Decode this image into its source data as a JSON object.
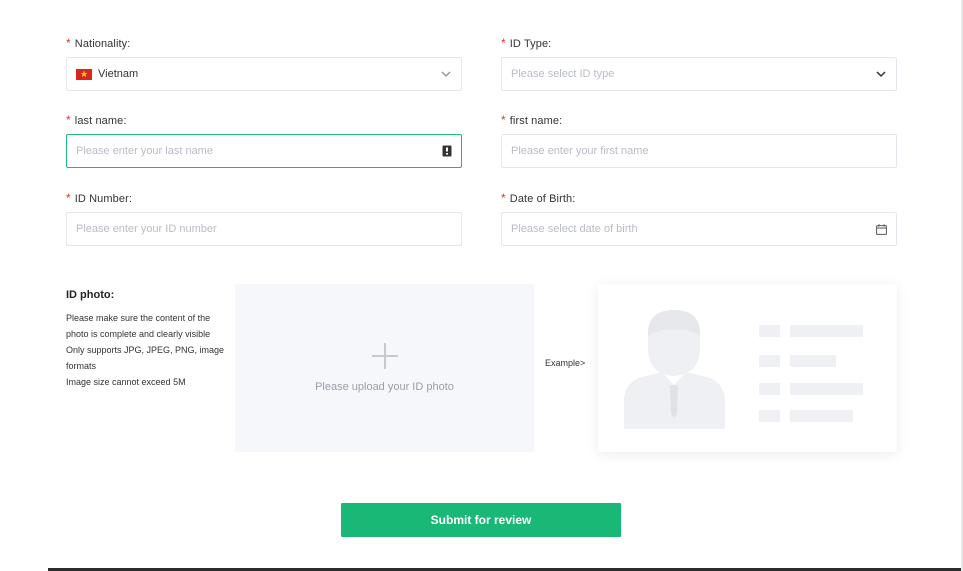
{
  "form": {
    "required_mark": "*",
    "nationality": {
      "label": "Nationality:",
      "value": "Vietnam",
      "flag_color": "#da251d"
    },
    "id_type": {
      "label": "ID Type:",
      "placeholder": "Please select ID type"
    },
    "last_name": {
      "label": "last name:",
      "placeholder": "Please enter your last name"
    },
    "first_name": {
      "label": "first name:",
      "placeholder": "Please enter your first name"
    },
    "id_number": {
      "label": "ID Number:",
      "placeholder": "Please enter your ID number"
    },
    "date_of_birth": {
      "label": "Date of Birth:",
      "placeholder": "Please select date of birth"
    }
  },
  "id_photo": {
    "title": "ID photo:",
    "notes": [
      "Please make sure the content of the photo is complete and clearly visible",
      "Only supports JPG, JPEG, PNG, image formats",
      "Image size cannot exceed 5M"
    ],
    "upload_text": "Please upload your ID photo",
    "example_label": "Example>"
  },
  "submit_label": "Submit for review",
  "colors": {
    "accent": "#1ab877",
    "focus_border": "#1fb97a",
    "required": "#e5322d",
    "placeholder": "#b8bcc4",
    "upload_bg": "#f6f7fb",
    "illustration": "#eff0f3"
  }
}
